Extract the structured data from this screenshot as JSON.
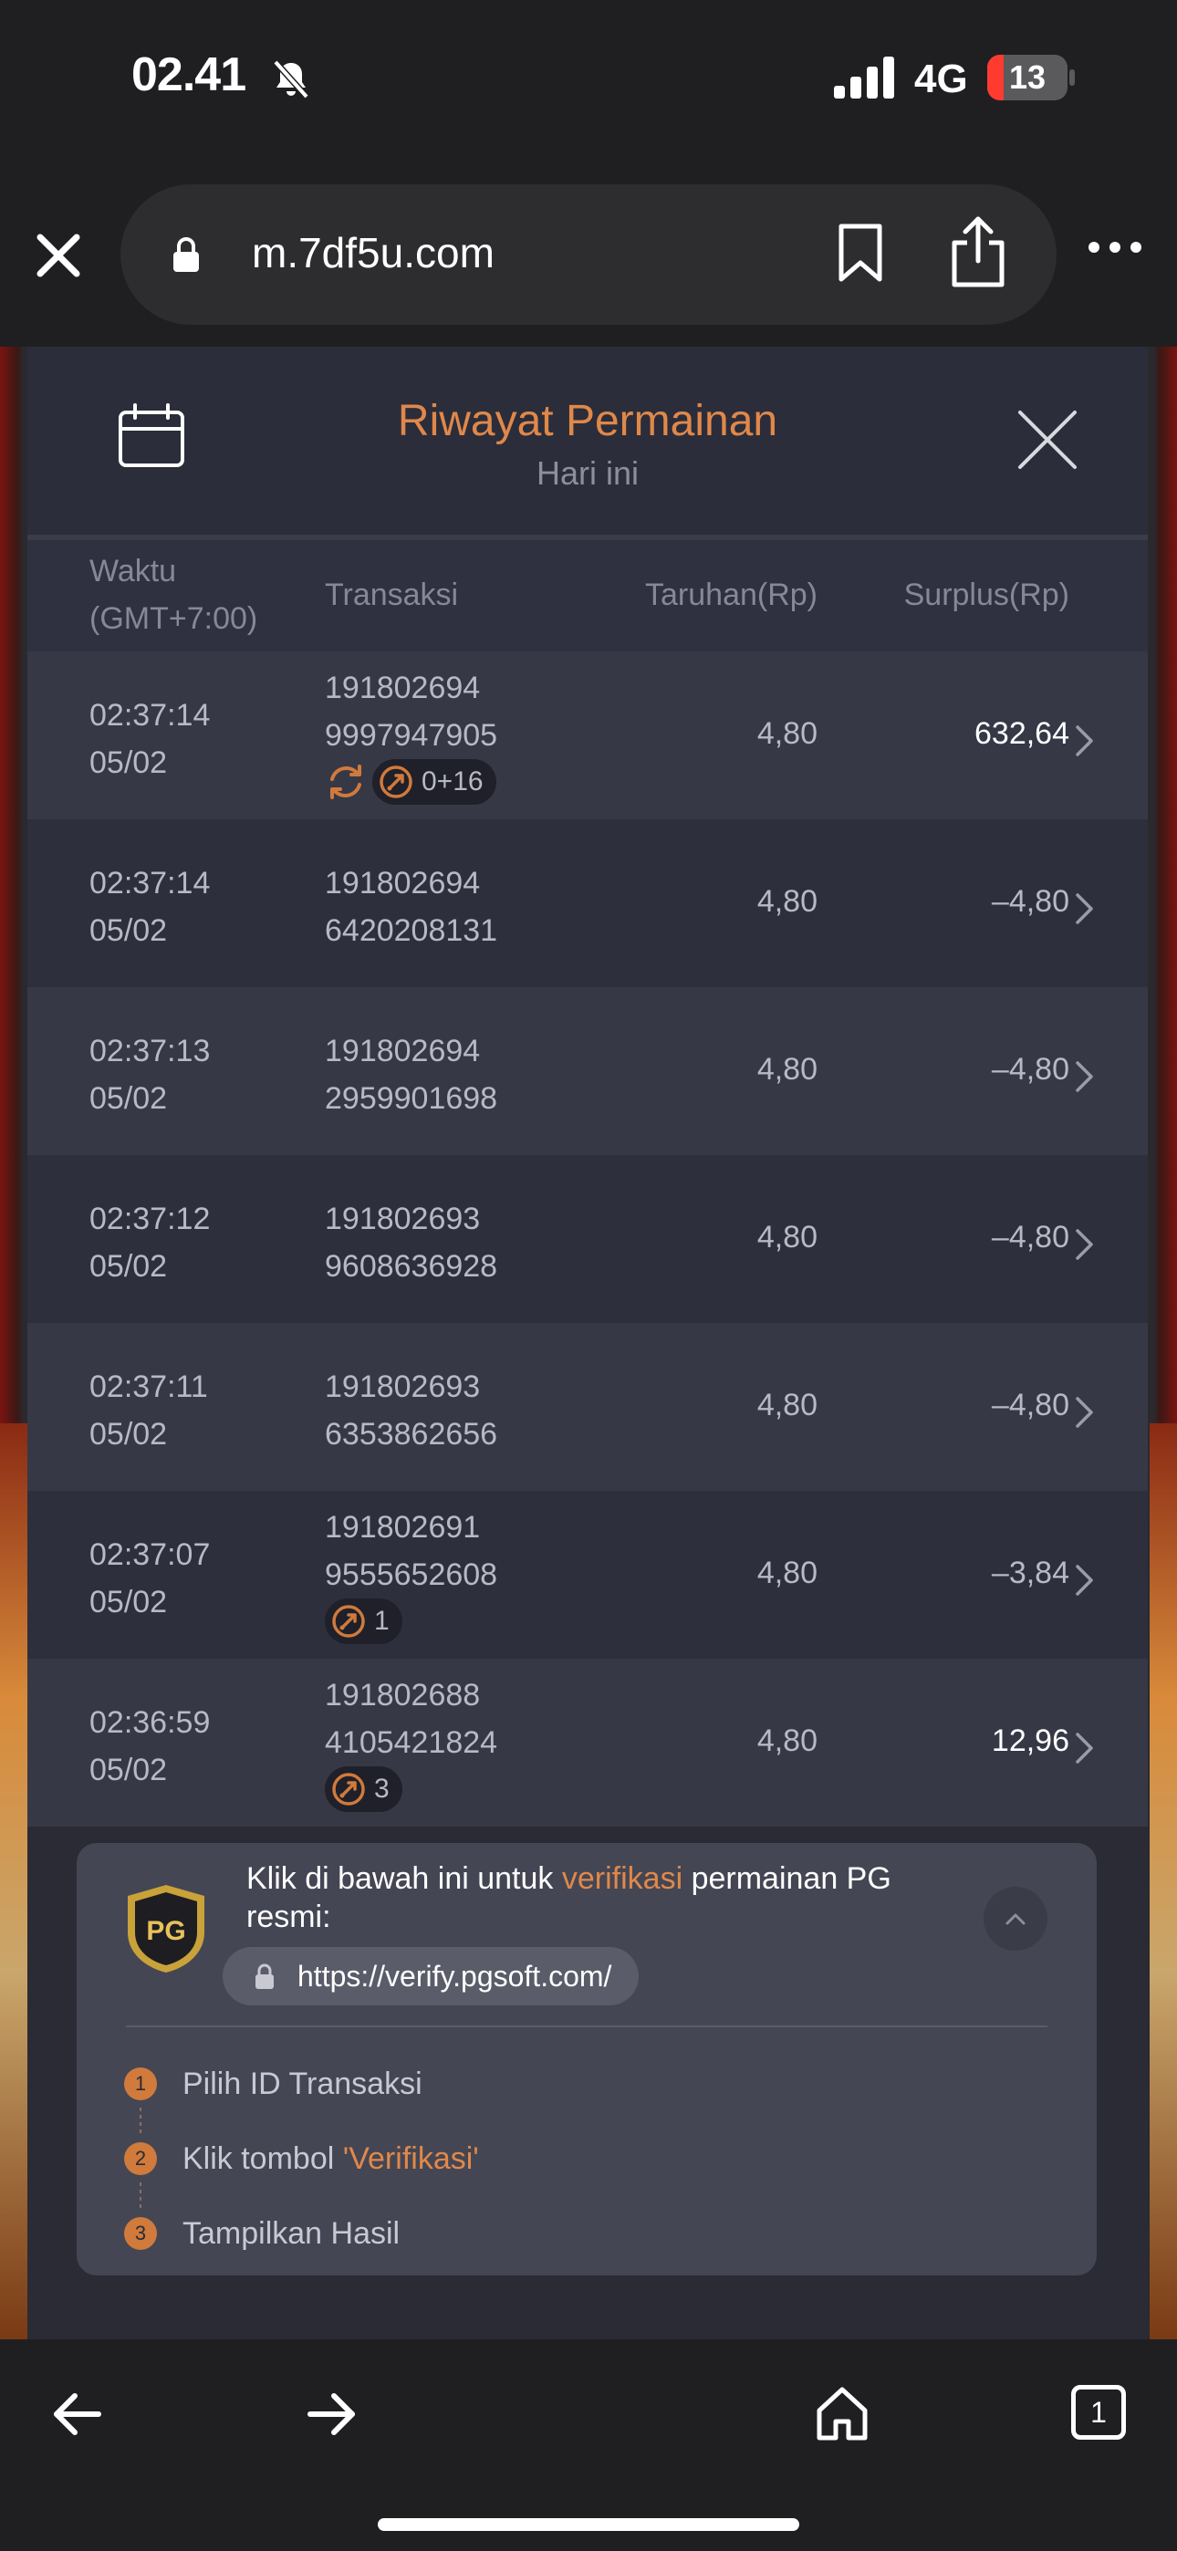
{
  "status_bar": {
    "time": "02.41",
    "network": "4G",
    "battery": "13",
    "icons": [
      "bell-slash-icon",
      "signal-icon",
      "battery-icon"
    ]
  },
  "browser": {
    "url": "m.7df5u.com",
    "icons": [
      "close-icon",
      "lock-icon",
      "bookmark-icon",
      "share-icon",
      "more-icon"
    ]
  },
  "panel": {
    "title": "Riwayat Permainan",
    "subtitle": "Hari ini",
    "columns": {
      "time_line1": "Waktu",
      "time_line2": "(GMT+7:00)",
      "transaction": "Transaksi",
      "bet": "Taruhan(Rp)",
      "surplus": "Surplus(Rp)"
    },
    "rows": [
      {
        "time": "02:37:14",
        "date": "05/02",
        "tx1": "191802694",
        "tx2": "9997947905",
        "bet": "4,80",
        "surplus": "632,64",
        "positive": true,
        "refresh": true,
        "badge": "0+16"
      },
      {
        "time": "02:37:14",
        "date": "05/02",
        "tx1": "191802694",
        "tx2": "6420208131",
        "bet": "4,80",
        "surplus": "–4,80",
        "positive": false
      },
      {
        "time": "02:37:13",
        "date": "05/02",
        "tx1": "191802694",
        "tx2": "2959901698",
        "bet": "4,80",
        "surplus": "–4,80",
        "positive": false
      },
      {
        "time": "02:37:12",
        "date": "05/02",
        "tx1": "191802693",
        "tx2": "9608636928",
        "bet": "4,80",
        "surplus": "–4,80",
        "positive": false
      },
      {
        "time": "02:37:11",
        "date": "05/02",
        "tx1": "191802693",
        "tx2": "6353862656",
        "bet": "4,80",
        "surplus": "–4,80",
        "positive": false
      },
      {
        "time": "02:37:07",
        "date": "05/02",
        "tx1": "191802691",
        "tx2": "9555652608",
        "bet": "4,80",
        "surplus": "–3,84",
        "positive": false,
        "badge": "1"
      },
      {
        "time": "02:36:59",
        "date": "05/02",
        "tx1": "191802688",
        "tx2": "4105421824",
        "bet": "4,80",
        "surplus": "12,96",
        "positive": true,
        "badge": "3"
      }
    ]
  },
  "verify": {
    "text_before": "Klik di bawah ini untuk ",
    "text_highlight": "verifikasi",
    "text_after": " permainan PG resmi:",
    "url": "https://verify.pgsoft.com/",
    "logo_text": "PG",
    "steps": [
      {
        "num": "1",
        "label": "Pilih ID Transaksi",
        "highlight": ""
      },
      {
        "num": "2",
        "label": "Klik tombol ",
        "highlight": "'Verifikasi'"
      },
      {
        "num": "3",
        "label": "Tampilkan Hasil",
        "highlight": ""
      }
    ]
  },
  "bottom_nav": {
    "tabs_count": "1",
    "icons": [
      "back-arrow-icon",
      "forward-arrow-icon",
      "home-icon",
      "tabs-icon"
    ]
  },
  "colors": {
    "accent": "#e0884a",
    "panel": "#2a2b34",
    "row_odd": "#363846",
    "row_even": "#2d2f3c",
    "card": "#444654"
  }
}
